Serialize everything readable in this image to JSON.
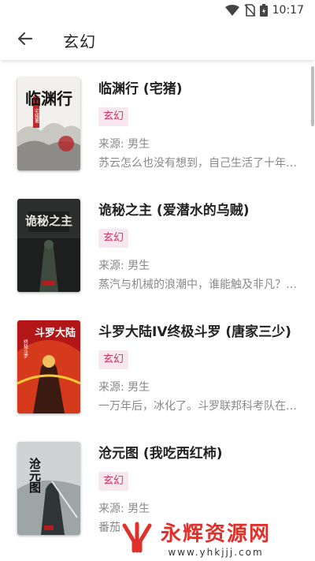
{
  "status": {
    "time": "10:17"
  },
  "header": {
    "title": "玄幻"
  },
  "books": [
    {
      "title": "临渊行 (宅猪)",
      "tag": "玄幻",
      "source": "来源: 男生",
      "desc": "苏云怎么也没有想到，自己生活了十年的地方竟然是一处…"
    },
    {
      "title": "诡秘之主 (爱潜水的乌贼)",
      "tag": "玄幻",
      "source": "来源: 男生",
      "desc": "蒸汽与机械的浪潮中，谁能触及非凡？历史和黑暗的迷雾…"
    },
    {
      "title": "斗罗大陆IV终极斗罗 (唐家三少)",
      "tag": "玄幻",
      "source": "来源: 男生",
      "desc": "一万年后，冰化了。斗罗联邦科考队在极北之地发现了…"
    },
    {
      "title": "沧元图 (我吃西红柿)",
      "tag": "玄幻",
      "source": "来源: 男生",
      "desc": "番茄…"
    }
  ],
  "covers": [
    {
      "art": "临渊行",
      "sub": "宅猪著"
    },
    {
      "art": "诡秘之主",
      "sub": ""
    },
    {
      "art": "斗罗大陆",
      "sub": "终极斗罗"
    },
    {
      "art": "沧元图",
      "sub": ""
    }
  ],
  "watermark": {
    "main": "永辉资源网",
    "url": "www.yhkjjj.com"
  },
  "colors": {
    "tag_bg": "#f8e7ee",
    "tag_text": "#d0345f",
    "watermark": "#e0302a"
  }
}
